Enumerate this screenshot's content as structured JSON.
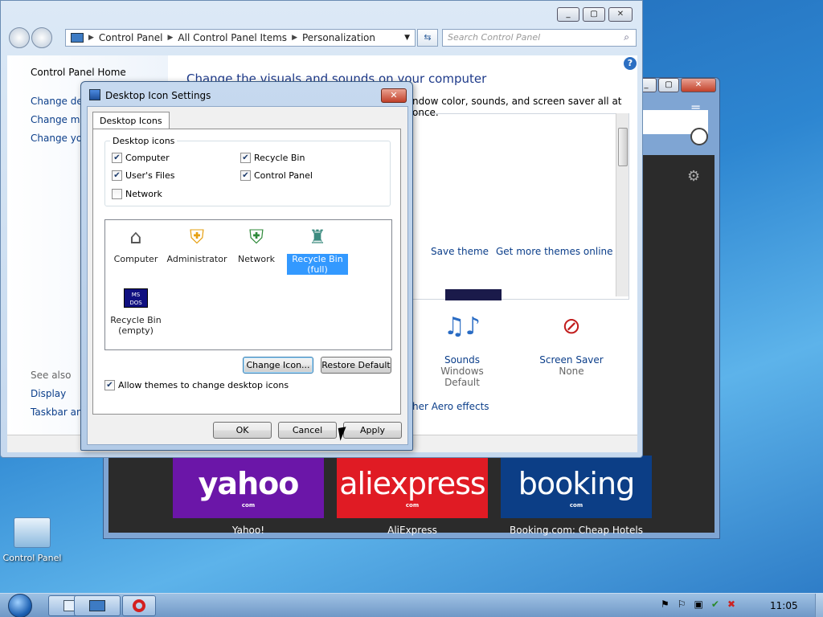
{
  "desktop": {
    "icon_label": "Control Panel"
  },
  "opera": {
    "tiles": [
      {
        "big": "yahoo",
        "com": "com",
        "label": "Yahoo!",
        "color": "#6b16a8"
      },
      {
        "big": "aliexpress",
        "com": "com",
        "label": "AliExpress",
        "color": "#e01b24"
      },
      {
        "big": "booking",
        "com": "com",
        "label": "Booking.com: Cheap Hotels",
        "color": "#0c3e86"
      }
    ]
  },
  "control_panel": {
    "breadcrumb": [
      "Control Panel",
      "All Control Panel Items",
      "Personalization"
    ],
    "search_placeholder": "Search Control Panel",
    "left": {
      "home": "Control Panel Home",
      "links": [
        "Change desktop icons",
        "Change mouse pointers",
        "Change your account picture"
      ],
      "links_visible": [
        "Change des",
        "Change mo",
        "Change you"
      ],
      "see_also": "See also",
      "see_also_links": [
        "Display",
        "Taskbar and"
      ]
    },
    "title": "Change the visuals and sounds on your computer",
    "subtitle_visible": "ndow color, sounds, and screen saver all at once.",
    "save_theme": "Save theme",
    "more_themes": "Get more themes online",
    "aero_link_visible": "her Aero effects",
    "sounds": {
      "label": "Sounds",
      "value": "Windows Default"
    },
    "screensaver": {
      "label": "Screen Saver",
      "value": "None"
    }
  },
  "dialog": {
    "title": "Desktop Icon Settings",
    "tab": "Desktop Icons",
    "group_title": "Desktop icons",
    "checkboxes": [
      {
        "label": "Computer",
        "checked": true
      },
      {
        "label": "Recycle Bin",
        "checked": true
      },
      {
        "label": "User's Files",
        "checked": true
      },
      {
        "label": "Control Panel",
        "checked": true
      },
      {
        "label": "Network",
        "checked": false
      }
    ],
    "icons": [
      {
        "label": "Computer",
        "selected": false
      },
      {
        "label": "Administrator",
        "selected": false
      },
      {
        "label": "Network",
        "selected": false
      },
      {
        "label": "Recycle Bin (full)",
        "selected": true
      },
      {
        "label": "Recycle Bin (empty)",
        "selected": false
      }
    ],
    "msdos_badge": "MS DOS",
    "change_icon": "Change Icon...",
    "restore_default": "Restore Default",
    "allow_themes": "Allow themes to change desktop icons",
    "allow_themes_checked": true,
    "ok": "OK",
    "cancel": "Cancel",
    "apply": "Apply"
  },
  "taskbar": {
    "clock": "11:05"
  }
}
